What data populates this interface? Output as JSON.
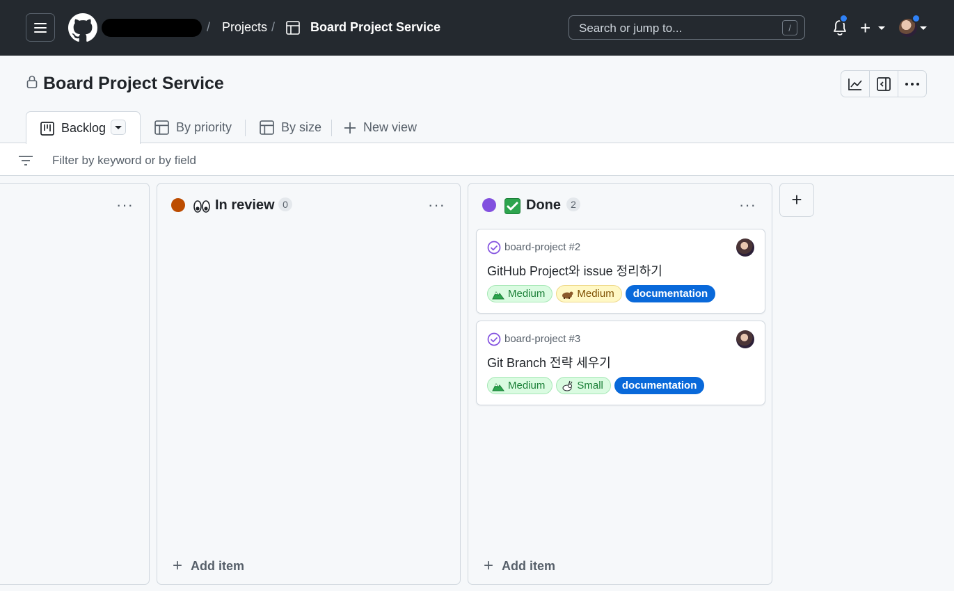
{
  "header": {
    "breadcrumb_projects": "Projects",
    "breadcrumb_separator": "/",
    "breadcrumb_project": "Board Project Service",
    "search_placeholder": "Search or jump to...",
    "search_shortcut": "/"
  },
  "project": {
    "title": "Board Project Service"
  },
  "tabs": [
    {
      "label": "Backlog",
      "active": true
    },
    {
      "label": "By priority"
    },
    {
      "label": "By size"
    },
    {
      "label": "New view"
    }
  ],
  "filter": {
    "placeholder": "Filter by keyword or by field"
  },
  "columns": [
    {
      "title": "",
      "count": ""
    },
    {
      "title": "In review",
      "count": "0",
      "color": "#bc4c00",
      "add_label": "Add item"
    },
    {
      "title": "Done",
      "count": "2",
      "color": "#8250df",
      "add_label": "Add item",
      "cards": [
        {
          "ref": "board-project #2",
          "title": "GitHub Project와 issue 정리하기",
          "labels": [
            "Medium",
            "Medium",
            "documentation"
          ]
        },
        {
          "ref": "board-project #3",
          "title": "Git Branch 전략 세우기",
          "labels": [
            "Medium",
            "Small",
            "documentation"
          ]
        }
      ]
    }
  ],
  "colors": {
    "header_bg": "#24292f",
    "accent_blue": "#0969da",
    "done_purple": "#8250df",
    "review_orange": "#bc4c00"
  }
}
